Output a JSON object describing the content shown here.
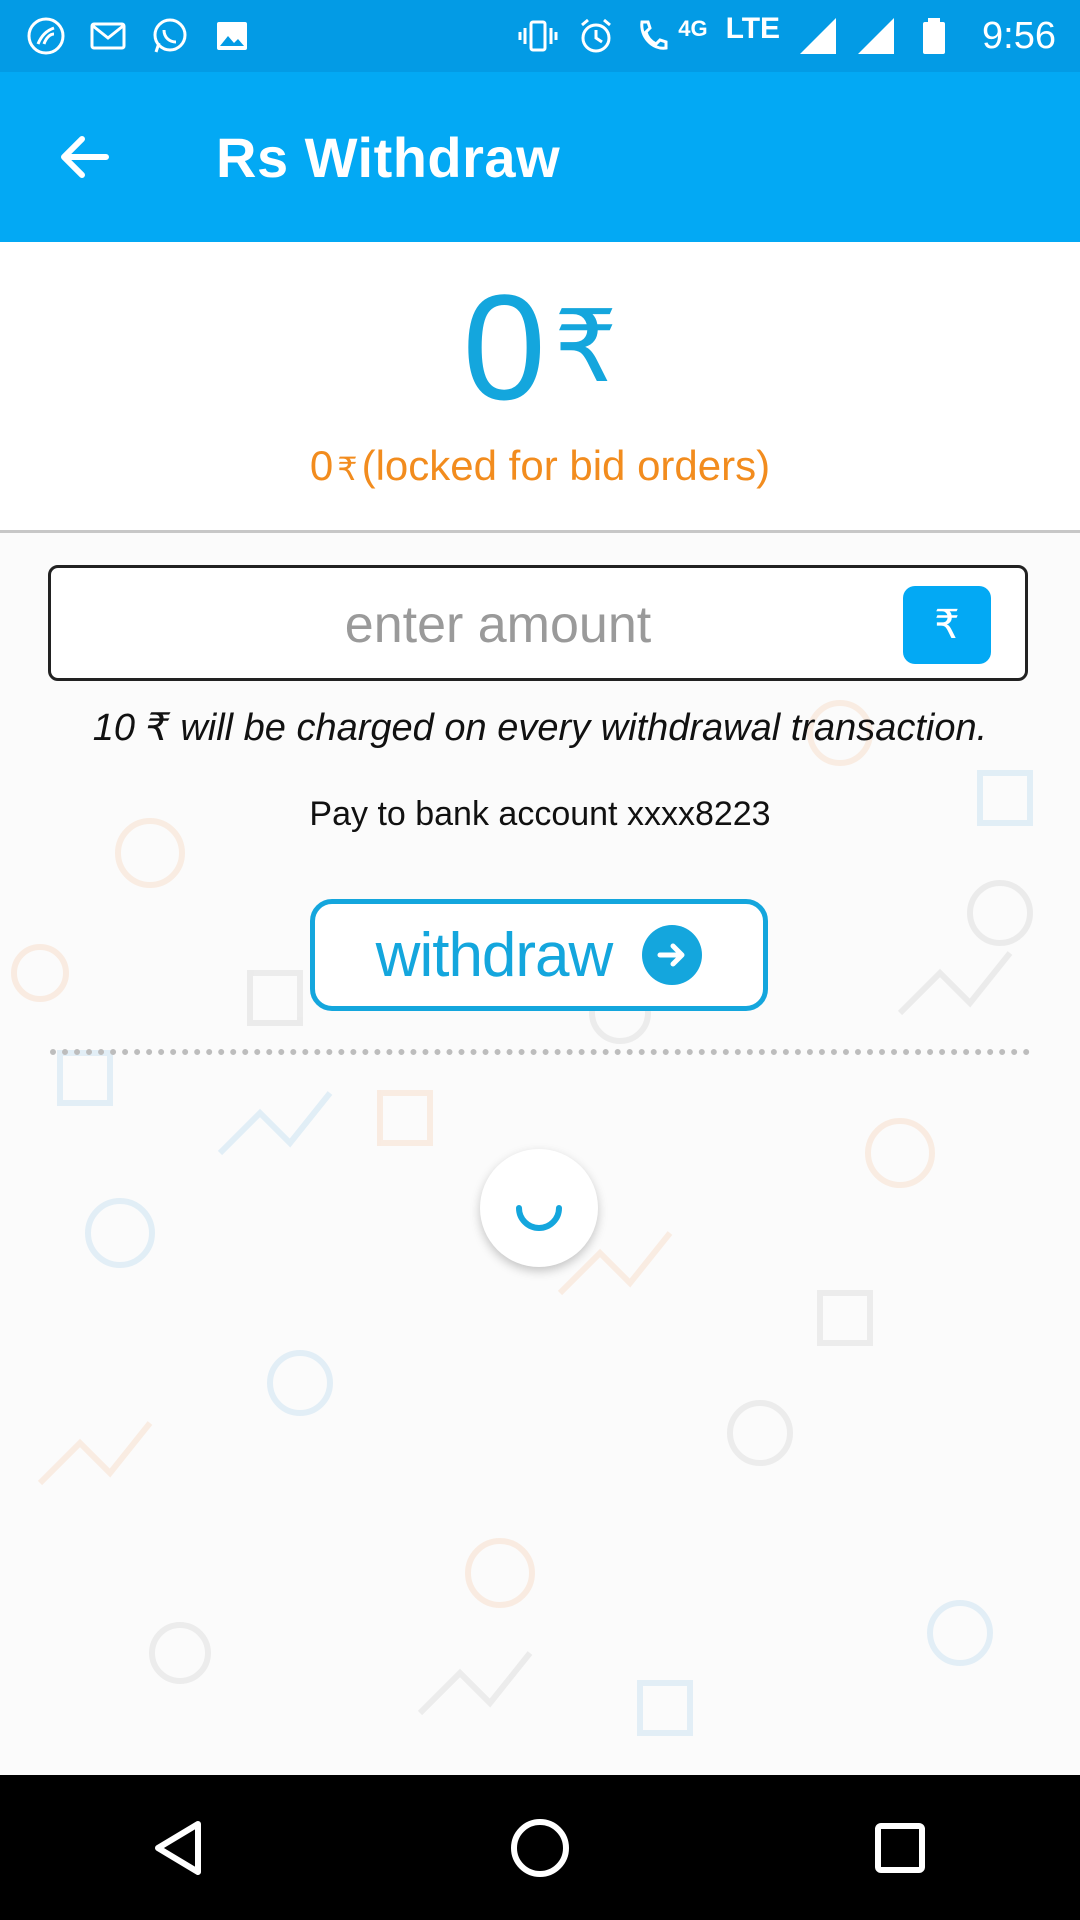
{
  "status_bar": {
    "network_label": "4G",
    "lte_label": "LTE",
    "time": "9:56",
    "icons": [
      "app-icon",
      "gmail-icon",
      "whatsapp-icon",
      "gallery-icon",
      "vibrate-icon",
      "alarm-icon",
      "volte-call-icon",
      "signal-icon",
      "signal-icon",
      "battery-icon"
    ]
  },
  "app_bar": {
    "title": "Rs Withdraw",
    "back_icon": "arrow-back-icon"
  },
  "balance": {
    "amount": "0",
    "symbol": "₹",
    "locked_amount": "0",
    "locked_symbol": "₹",
    "locked_text": "(locked for bid orders)"
  },
  "form": {
    "amount_placeholder": "enter amount",
    "amount_value": "",
    "currency_button": "₹",
    "fee_note": "10 ₹ will be charged on every withdrawal transaction.",
    "bank_line": "Pay to bank account xxxx8223",
    "withdraw_label": "withdraw"
  },
  "colors": {
    "status_bar": "#039be5",
    "app_bar": "#03a9f4",
    "accent": "#14a6dd",
    "locked": "#f28c1e"
  }
}
